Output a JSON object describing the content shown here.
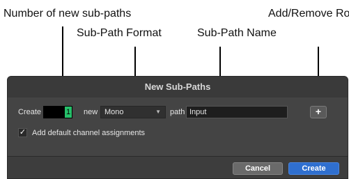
{
  "annotations": {
    "num_subpaths": "Number of new sub-paths",
    "subpath_format": "Sub-Path Format",
    "subpath_name": "Sub-Path Name",
    "add_remove_row": "Add/Remove Row"
  },
  "dialog": {
    "title": "New Sub-Paths",
    "create_label": "Create",
    "count_value": "1",
    "new_label": "new",
    "format_value": "Mono",
    "path_label": "path",
    "path_name_value": "Input",
    "add_row_button": "+",
    "default_channels_checkbox": {
      "label": "Add default channel assignments",
      "checked": true,
      "mark": "✓"
    },
    "cancel_button": "Cancel",
    "create_button": "Create"
  },
  "colors": {
    "count_field_fill": "#26c06a",
    "create_button_bg": "#2f6fcf"
  }
}
